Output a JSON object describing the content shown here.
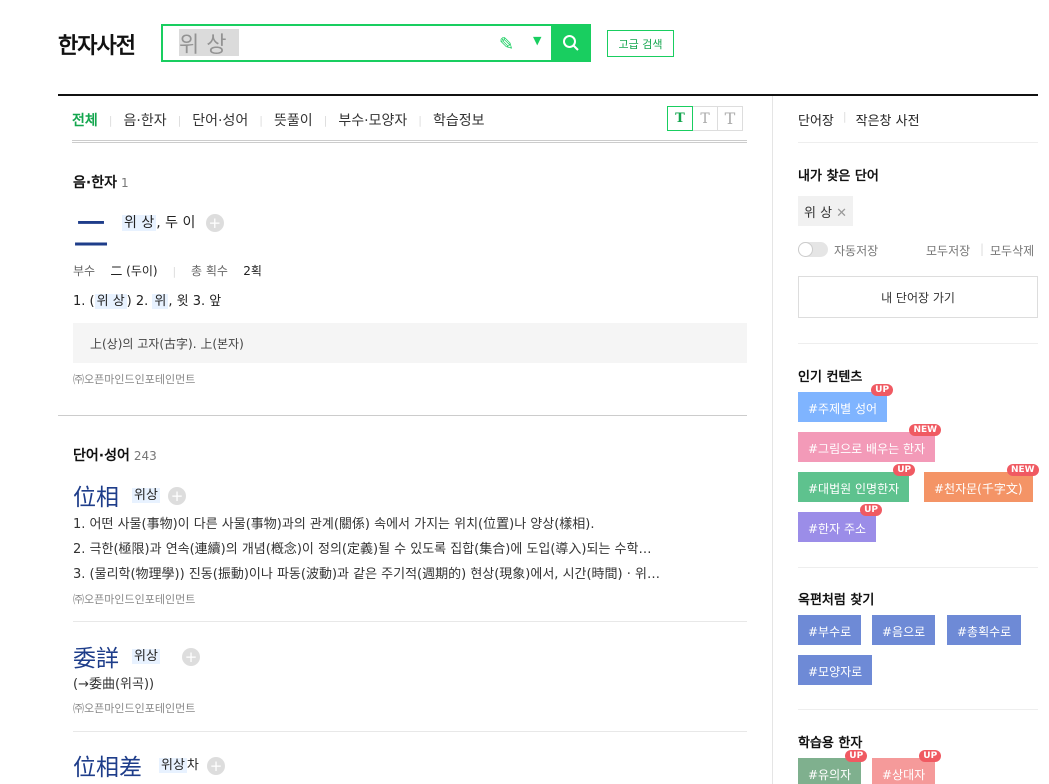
{
  "header": {
    "logo": "한자사전",
    "search_value": "위 상",
    "advanced_label": "고급 검색"
  },
  "tabs": [
    "전체",
    "음·한자",
    "단어·성어",
    "뜻풀이",
    "부수·모양자",
    "학습정보"
  ],
  "text_size": [
    "T",
    "T",
    "T"
  ],
  "section_hanja": {
    "title": "음·한자",
    "count": "1",
    "char": "二",
    "reading_hl": "위 상",
    "reading_rest": ", 두 이",
    "radical_label": "부수",
    "radical_value": "二 (두이)",
    "strokes_label": "총 획수",
    "strokes_value": "2획",
    "meaning_prefix": "1. (",
    "meaning_hl1": "위 상",
    "meaning_mid": ")  2. ",
    "meaning_hl2": "위",
    "meaning_rest": ", 윗  3. 앞",
    "note": "上(상)의 고자(古字). 上(본자)",
    "source": "㈜오픈마인드인포테인먼트"
  },
  "section_words": {
    "title": "단어·성어",
    "count": "243",
    "items": [
      {
        "hanja": "位相",
        "reading": "위상",
        "defs": [
          "1. 어떤 사물(事物)이 다른 사물(事物)과의 관계(關係) 속에서 가지는 위치(位置)나 양상(樣相).",
          "2. 극한(極限)과 연속(連續)의 개념(槪念)이 정의(定義)될 수 있도록 집합(集合)에 도입(導入)되는 수학…",
          "3. (물리학(物理學)) 진동(振動)이나 파동(波動)과 같은 주기적(週期的) 현상(現象)에서, 시간(時間) · 위…"
        ],
        "source": "㈜오픈마인드인포테인먼트"
      },
      {
        "hanja": "委詳",
        "reading": "위상",
        "defs": [
          "(→委曲(위곡))"
        ],
        "source": "㈜오픈마인드인포테인먼트"
      },
      {
        "hanja": "位相差",
        "reading_hl": "위상",
        "reading_rest": "차"
      }
    ]
  },
  "sidebar": {
    "head_links": [
      "단어장",
      "작은창 사전"
    ],
    "my_words_title": "내가 찾은 단어",
    "my_word": "위 상",
    "autosave_label": "자동저장",
    "save_all": "모두저장",
    "delete_all": "모두삭제",
    "wordbook_btn": "내 단어장 가기",
    "popular_title": "인기 컨텐츠",
    "popular_tags": [
      {
        "label": "#주제별 성어",
        "badge": "UP"
      },
      {
        "label": "#그림으로 배우는 한자",
        "badge": "NEW"
      },
      {
        "label": "#대법원 인명한자",
        "badge": "UP"
      },
      {
        "label": "#천자문(千字文)",
        "badge": "NEW"
      },
      {
        "label": "#한자 주소",
        "badge": "UP"
      }
    ],
    "okpyeon_title": "옥편처럼 찾기",
    "okpyeon_tags": [
      "#부수로",
      "#음으로",
      "#총획수로",
      "#모양자로"
    ],
    "study_title": "학습용 한자",
    "study_tags": [
      {
        "label": "#유의자",
        "badge": "UP"
      },
      {
        "label": "#상대자",
        "badge": "UP"
      }
    ]
  },
  "colors": {
    "accent": "#19ce60",
    "hanja_blue": "#1e3d8a",
    "highlight": "#e8f2ff"
  }
}
